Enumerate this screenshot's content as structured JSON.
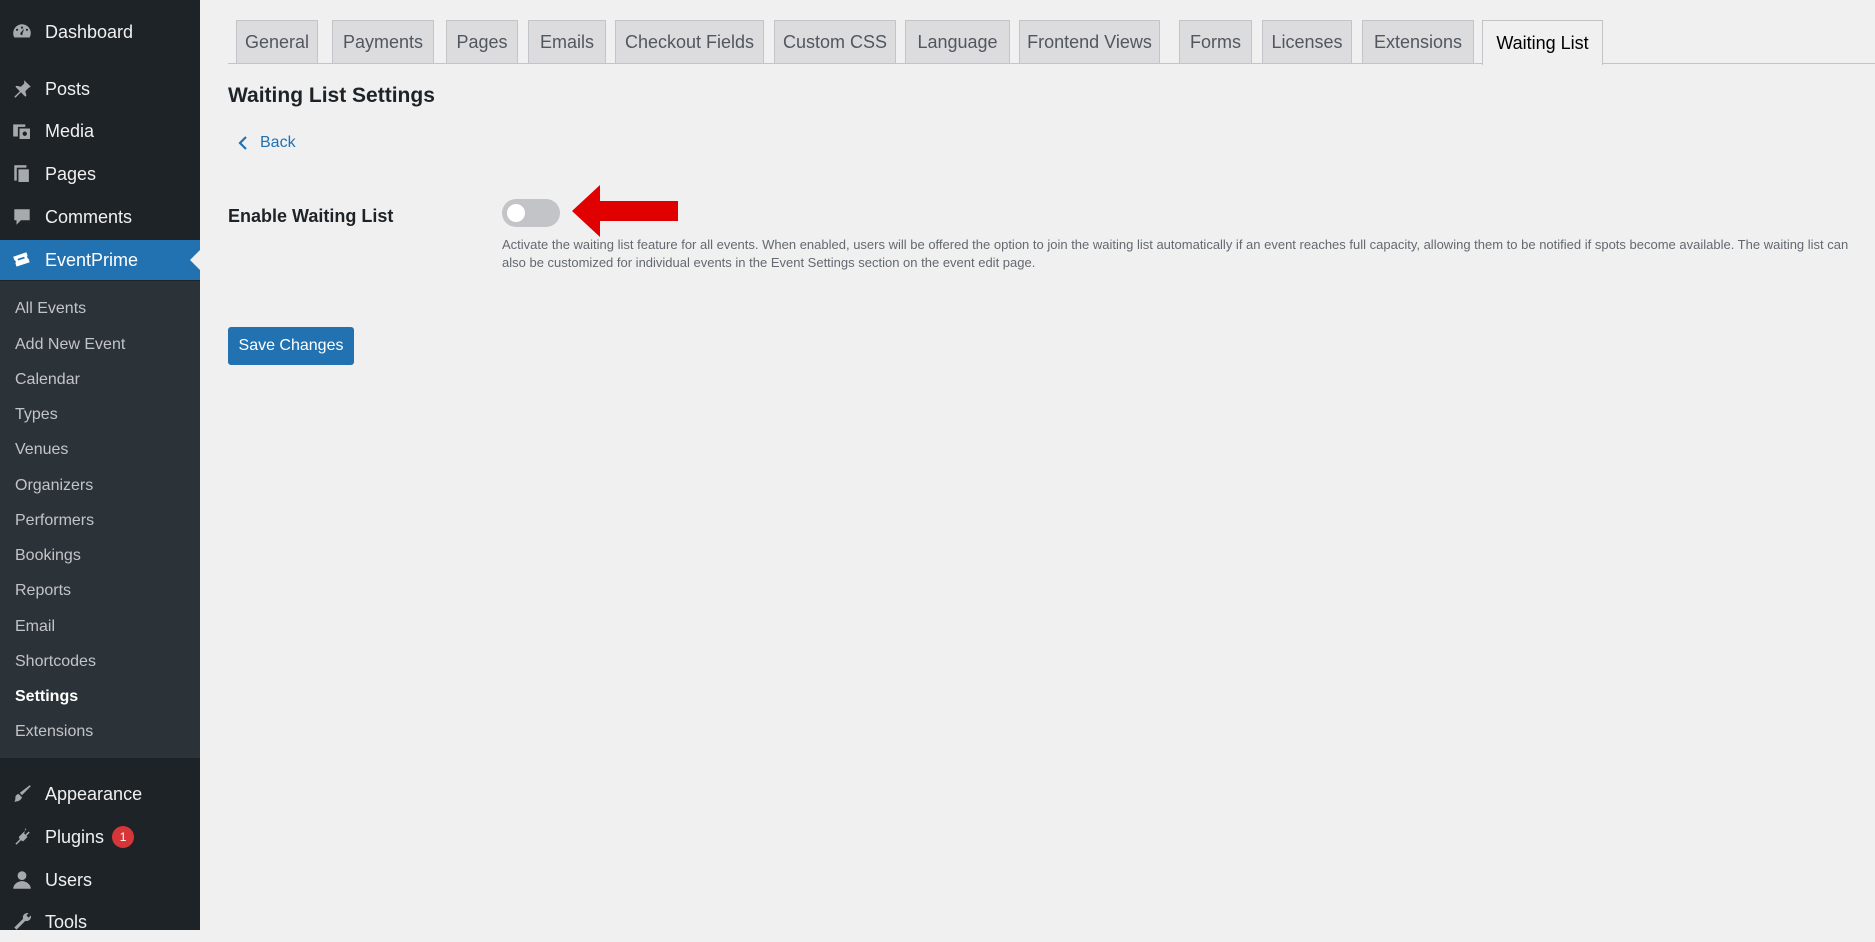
{
  "sidebar": {
    "top_items": [
      {
        "label": "Dashboard",
        "icon": "dashboard-icon"
      },
      {
        "label": "Posts",
        "icon": "pin-icon"
      },
      {
        "label": "Media",
        "icon": "media-icon"
      },
      {
        "label": "Pages",
        "icon": "pages-icon"
      },
      {
        "label": "Comments",
        "icon": "comment-icon"
      },
      {
        "label": "EventPrime",
        "icon": "tickets-icon"
      }
    ],
    "submenu": [
      "All Events",
      "Add New Event",
      "Calendar",
      "Types",
      "Venues",
      "Organizers",
      "Performers",
      "Bookings",
      "Reports",
      "Email",
      "Shortcodes",
      "Settings",
      "Extensions"
    ],
    "bottom_items": [
      {
        "label": "Appearance",
        "icon": "brush-icon"
      },
      {
        "label": "Plugins",
        "icon": "plugin-icon",
        "badge": "1"
      },
      {
        "label": "Users",
        "icon": "user-icon"
      },
      {
        "label": "Tools",
        "icon": "wrench-icon"
      }
    ],
    "active_item": "EventPrime",
    "current_submenu": "Settings"
  },
  "tabs": [
    "General",
    "Payments",
    "Pages",
    "Emails",
    "Checkout Fields",
    "Custom CSS",
    "Language",
    "Frontend Views",
    "Forms",
    "Licenses",
    "Extensions",
    "Waiting List"
  ],
  "active_tab": "Waiting List",
  "page": {
    "title": "Waiting List Settings",
    "back_label": "Back",
    "field_label": "Enable Waiting List",
    "toggle_on": false,
    "description": "Activate the waiting list feature for all events. When enabled, users will be offered the option to join the waiting list automatically if an event reaches full capacity, allowing them to be notified if spots become available. The waiting list can also be customized for individual events in the Event Settings section on the event edit page.",
    "save_label": "Save Changes"
  },
  "colors": {
    "sidebar_bg": "#1d2327",
    "submenu_bg": "#2c3338",
    "accent": "#2271b1",
    "badge": "#d63638",
    "arrow": "#e00000"
  }
}
